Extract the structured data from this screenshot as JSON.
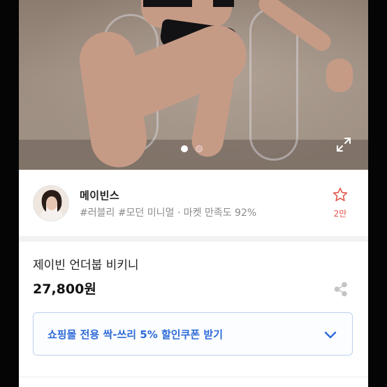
{
  "photo": {
    "indicator": {
      "total": 2,
      "active": 1
    },
    "icons": {
      "expand": "expand-icon"
    }
  },
  "seller": {
    "name": "메이빈스",
    "tags": "#러블리 #모던 미니멀 · 마켓 만족도 92%",
    "favorite_count": "2만",
    "icons": {
      "favorite": "star-outline-icon",
      "avatar": "avatar"
    }
  },
  "product": {
    "title": "제이빈 언더붑 비키니",
    "price": "27,800원",
    "icons": {
      "share": "share-icon"
    }
  },
  "coupon": {
    "label": "쇼핑몰 전용 싹-쓰리 5% 할인쿠폰 받기",
    "icons": {
      "toggle": "chevron-down-icon"
    }
  },
  "colors": {
    "accent_blue": "#2d6ad9",
    "favorite_red": "#e2584c",
    "text_dark": "#222222",
    "text_muted": "#8a8a8a"
  }
}
